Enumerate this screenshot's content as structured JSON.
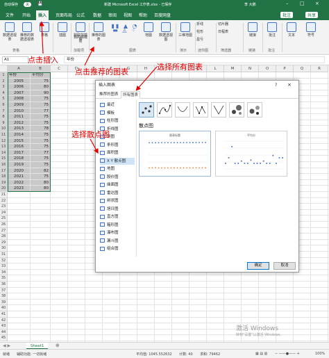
{
  "titlebar": {
    "autosave": "自动保存",
    "autosave_state": "关",
    "doc_title": "新建 Microsoft Excel 工作表.xlsx - 已保存",
    "user": "李 大鹏"
  },
  "tabs": [
    "文件",
    "开始",
    "插入",
    "页面布局",
    "公式",
    "数据",
    "审阅",
    "视图",
    "帮助",
    "百度网盘"
  ],
  "tabs_right": {
    "comment": "批注",
    "share": "共享"
  },
  "ribbon": {
    "buttons": [
      "数据透视表",
      "推荐的数据透视表",
      "表格",
      "插图",
      "获取加载项",
      "我的加载项",
      "推荐的图表",
      "地图",
      "数据透视图",
      "三维地图",
      "折线",
      "柱形",
      "盈亏",
      "切片器",
      "日程表",
      "链接",
      "批注",
      "文本",
      "符号"
    ],
    "groups": [
      "表格",
      "加载项",
      "图表",
      "演示",
      "迷你图",
      "筛选器",
      "链接",
      "批注"
    ]
  },
  "formula_bar": {
    "name_box": "A1",
    "formula": "年份"
  },
  "sheet": {
    "columns": [
      "A",
      "B",
      "C",
      "D",
      "E",
      "F",
      "G",
      "H",
      "I",
      "J",
      "K",
      "L",
      "M",
      "N",
      "O",
      "P",
      "Q",
      "R"
    ],
    "headers": [
      "年份",
      "平均分"
    ],
    "rows": [
      [
        "2005",
        "75"
      ],
      [
        "2006",
        "80"
      ],
      [
        "2007",
        "90"
      ],
      [
        "2008",
        "75"
      ],
      [
        "2009",
        "75"
      ],
      [
        "2010",
        "77"
      ],
      [
        "2011",
        "75"
      ],
      [
        "2012",
        "75"
      ],
      [
        "2013",
        "78"
      ],
      [
        "2014",
        "75"
      ],
      [
        "2015",
        "75"
      ],
      [
        "2016",
        "75"
      ],
      [
        "2017",
        "77"
      ],
      [
        "2018",
        "75"
      ],
      [
        "2019",
        "75"
      ],
      [
        "2020",
        "82"
      ],
      [
        "2021",
        "75"
      ],
      [
        "2022",
        "80"
      ],
      [
        "2023",
        "80"
      ]
    ],
    "tab_name": "Sheet1"
  },
  "dialog": {
    "title": "插入图表",
    "help": "?",
    "close": "×",
    "tabs": [
      "推荐的图表",
      "所有图表"
    ],
    "chart_types": [
      "最近",
      "模板",
      "柱形图",
      "折线图",
      "饼图",
      "条形图",
      "面积图",
      "X Y 散点图",
      "地图",
      "股价图",
      "曲面图",
      "雷达图",
      "树状图",
      "旭日图",
      "直方图",
      "箱形图",
      "瀑布图",
      "漏斗图",
      "组合图"
    ],
    "section_title": "散点图",
    "preview1_title": "图表标题",
    "preview2_title": "平均分",
    "ok": "确定",
    "cancel": "取消"
  },
  "annotations": {
    "a1": "点击插入",
    "a2": "点击推荐的图表",
    "a3": "选择所有图表",
    "a4": "选择散点图"
  },
  "status": {
    "ready": "就绪",
    "accessibility": "辅助功能: 一切就绪",
    "average": "平均值: 1045.552632",
    "count": "计数: 40",
    "sum": "求和: 79462",
    "zoom": "100%"
  },
  "watermark": {
    "line1": "激活 Windows",
    "line2": "转到\"设置\"以激活 Windows。"
  },
  "colors": {
    "excel_green": "#217346",
    "annotation_red": "#e60000",
    "selection": "#c8c8c8"
  }
}
